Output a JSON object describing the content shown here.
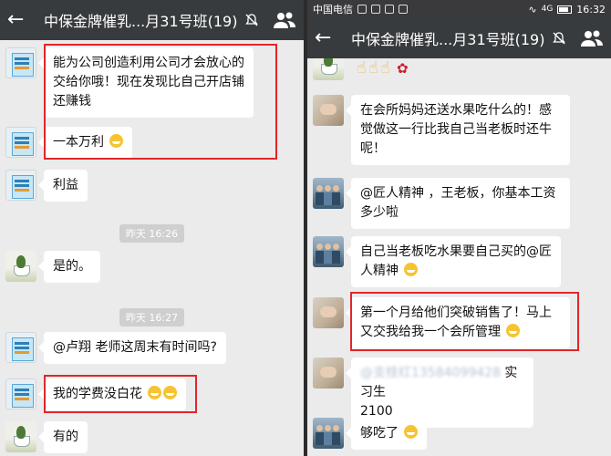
{
  "left": {
    "title": "中保金牌催乳...月31号班(19)",
    "messages": [
      {
        "text": "能为公司创造利用公司才会放心的交给你哦！现在发现比自己开店铺还赚钱"
      },
      {
        "text": "一本万利"
      },
      {
        "text": "利益"
      },
      {
        "timestamp": "昨天 16:26"
      },
      {
        "text": "是的。"
      },
      {
        "timestamp": "昨天 16:27"
      },
      {
        "text": "@卢翔 老师这周末有时间吗?"
      },
      {
        "text": "我的学费没白花"
      },
      {
        "text": "有的"
      }
    ]
  },
  "right": {
    "status": {
      "carrier": "中国电信",
      "network": "4G",
      "time": "16:32"
    },
    "title": "中保金牌催乳...月31号班(19)",
    "messages": [
      {
        "text": "在会所妈妈还送水果吃什么的！感觉做这一行比我自己当老板时还牛呢！"
      },
      {
        "text": "@匠人精神 ，王老板，你基本工资多少啦"
      },
      {
        "text": "自己当老板吃水果要自己买的@匠人精神"
      },
      {
        "text": "第一个月给他们突破销售了！马上又交我给我一个会所管理"
      },
      {
        "text_blur": "@支桂红13584099428",
        "text_tail": " 实习生",
        "text_line2": "2100"
      },
      {
        "text": "够吃了"
      }
    ]
  },
  "icons": [
    "back-arrow-icon",
    "mute-bell-icon",
    "group-members-icon",
    "thumbs-up-icon",
    "rose-icon",
    "grin-emoji-icon",
    "smirk-emoji-icon"
  ],
  "colors": {
    "titlebar": "#373b3e",
    "chat_bg": "#ebebeb",
    "highlight": "#e0262b",
    "bubble": "#ffffff"
  }
}
